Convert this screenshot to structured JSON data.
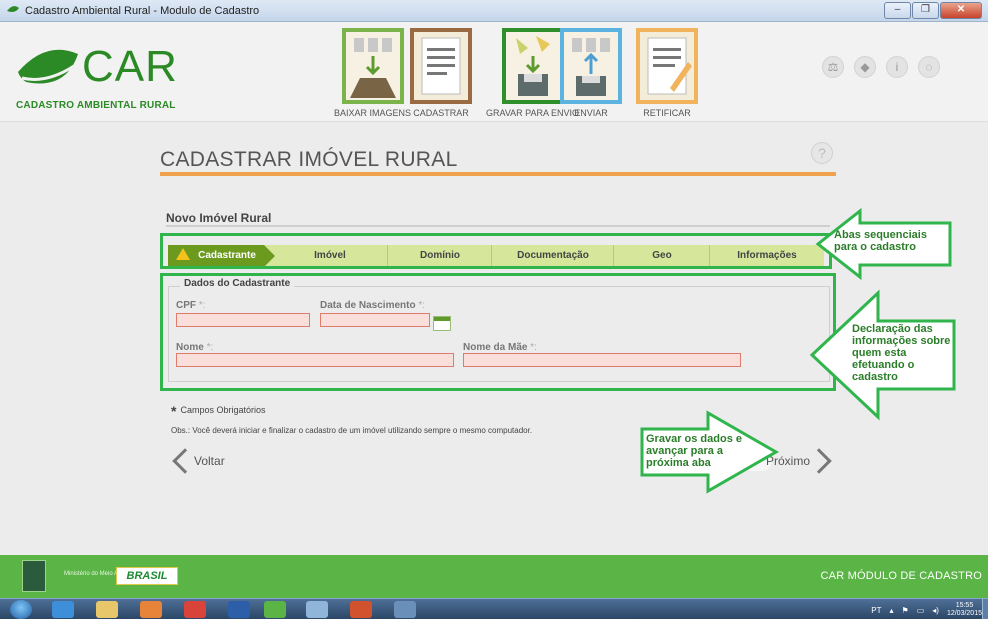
{
  "window": {
    "title": "Cadastro Ambiental Rural - Modulo de Cadastro",
    "minimize": "–",
    "maximize": "❐",
    "close": "✕"
  },
  "logo": {
    "brand": "CAR",
    "subtitle": "CADASTRO AMBIENTAL RURAL"
  },
  "nav": {
    "items": [
      {
        "label": "BAIXAR IMAGENS"
      },
      {
        "label": "CADASTRAR"
      },
      {
        "label": "GRAVAR PARA ENVIO"
      },
      {
        "label": "ENVIAR"
      },
      {
        "label": "RETIFICAR"
      }
    ]
  },
  "header_icons": [
    "scale-icon",
    "book-icon",
    "info-icon",
    "sync-icon"
  ],
  "page": {
    "title": "CADASTRAR IMÓVEL RURAL",
    "help": "?"
  },
  "section": {
    "title": "Novo Imóvel Rural"
  },
  "tabs": [
    {
      "label": "Cadastrante",
      "active": true
    },
    {
      "label": "Imóvel"
    },
    {
      "label": "Domínio"
    },
    {
      "label": "Documentação"
    },
    {
      "label": "Geo"
    },
    {
      "label": "Informações"
    }
  ],
  "form": {
    "legend": "Dados do Cadastrante",
    "required_mark": "*:",
    "fields": {
      "cpf": {
        "label": "CPF",
        "value": ""
      },
      "nascimento": {
        "label": "Data de Nascimento",
        "value": ""
      },
      "nome": {
        "label": "Nome",
        "value": ""
      },
      "nome_mae": {
        "label": "Nome da Mãe",
        "value": ""
      }
    }
  },
  "notes": {
    "required_star": "*",
    "required": "Campos Obrigatórios",
    "obs": "Obs.: Você deverá iniciar e finalizar o cadastro de um imóvel utilizando sempre o mesmo computador."
  },
  "buttons": {
    "back": "Voltar",
    "next": "Próximo"
  },
  "annotations": {
    "tabs": "Abas sequenciais para o cadastro",
    "form": "Declaração das informações sobre quem esta efetuando o cadastro",
    "next": "Gravar os dados e avançar para a próxima aba"
  },
  "footer": {
    "ministry": "Ministério do Meio Ambiente",
    "brasil": "BRASIL",
    "module": "CAR  MÓDULO DE CADASTRO"
  },
  "taskbar": {
    "lang": "PT",
    "time": "15:55",
    "date": "12/03/2015"
  },
  "colors": {
    "brand_green": "#2c8a26",
    "accent_orange": "#f0a24c",
    "annotation_green": "#2fb54c"
  }
}
